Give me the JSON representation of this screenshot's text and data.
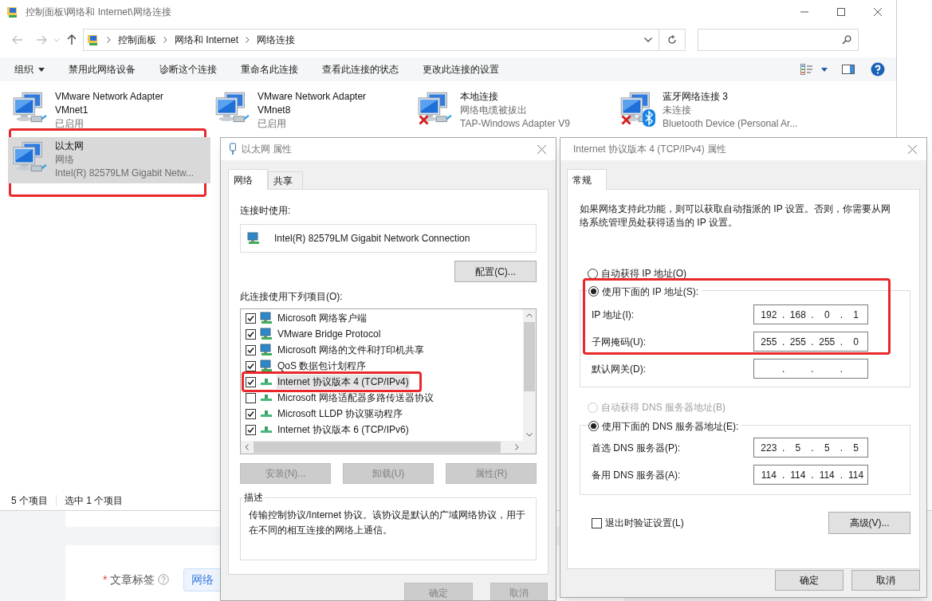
{
  "explorer": {
    "title": "控制面板\\网络和 Internet\\网络连接",
    "breadcrumbs": [
      "控制面板",
      "网络和 Internet",
      "网络连接"
    ],
    "organize": "组织",
    "commands": [
      "禁用此网络设备",
      "诊断这个连接",
      "重命名此连接",
      "查看此连接的状态",
      "更改此连接的设置"
    ],
    "adapters": [
      {
        "name_lines": [
          "VMware Network Adapter",
          "VMnet1"
        ],
        "details": [
          "已启用"
        ],
        "connected": true,
        "bluetooth": false,
        "selected": false,
        "annotated": false
      },
      {
        "name_lines": [
          "VMware Network Adapter",
          "VMnet8"
        ],
        "details": [
          "已启用"
        ],
        "connected": true,
        "bluetooth": false,
        "selected": false,
        "annotated": false
      },
      {
        "name_lines": [
          "本地连接"
        ],
        "details": [
          "网络电缆被拔出",
          "TAP-Windows Adapter V9"
        ],
        "connected": false,
        "bluetooth": false,
        "selected": false,
        "annotated": false
      },
      {
        "name_lines": [
          "蓝牙网络连接 3"
        ],
        "details": [
          "未连接",
          "Bluetooth Device (Personal Ar..."
        ],
        "connected": false,
        "bluetooth": true,
        "selected": false,
        "annotated": false
      },
      {
        "name_lines": [
          "以太网"
        ],
        "details": [
          "网络",
          "Intel(R) 82579LM Gigabit Netw..."
        ],
        "connected": true,
        "bluetooth": false,
        "selected": true,
        "annotated": true
      }
    ],
    "status_bar": [
      "5 个项目",
      "选中 1 个项目"
    ]
  },
  "background_page": {
    "required_mark": "*",
    "label": "文章标签",
    "tag": "网络"
  },
  "ethernet_dialog": {
    "title": "以太网 属性",
    "tabs": [
      {
        "label": "网络",
        "selected": true
      },
      {
        "label": "共享",
        "selected": false
      }
    ],
    "connect_using_label": "连接时使用:",
    "adapter": "Intel(R) 82579LM Gigabit Network Connection",
    "configure_button": "配置(C)...",
    "items_label": "此连接使用下列项目(O):",
    "items": [
      {
        "label": "Microsoft 网络客户端",
        "kind": "client",
        "checked": true,
        "selected": false,
        "annotated": false
      },
      {
        "label": "VMware Bridge Protocol",
        "kind": "service",
        "checked": true,
        "selected": false,
        "annotated": false
      },
      {
        "label": "Microsoft 网络的文件和打印机共享",
        "kind": "service",
        "checked": true,
        "selected": false,
        "annotated": false
      },
      {
        "label": "QoS 数据包计划程序",
        "kind": "service",
        "checked": true,
        "selected": false,
        "annotated": false
      },
      {
        "label": "Internet 协议版本 4 (TCP/IPv4)",
        "kind": "protocol",
        "checked": true,
        "selected": true,
        "annotated": true
      },
      {
        "label": "Microsoft 网络适配器多路传送器协议",
        "kind": "protocol",
        "checked": false,
        "selected": false,
        "annotated": false
      },
      {
        "label": "Microsoft LLDP 协议驱动程序",
        "kind": "protocol",
        "checked": true,
        "selected": false,
        "annotated": false
      },
      {
        "label": "Internet 协议版本 6 (TCP/IPv6)",
        "kind": "protocol",
        "checked": true,
        "selected": false,
        "annotated": false
      }
    ],
    "buttons": [
      {
        "label": "安装(N)...",
        "disabled": true
      },
      {
        "label": "卸载(U)",
        "disabled": true
      },
      {
        "label": "属性(R)",
        "disabled": true
      }
    ],
    "description_legend": "描述",
    "description": "传输控制协议/Internet 协议。该协议是默认的广域网络协议，用于在不同的相互连接的网络上通信。",
    "footer_buttons": [
      {
        "label": "确定",
        "disabled": true
      },
      {
        "label": "取消",
        "disabled": true
      }
    ]
  },
  "ipv4_dialog": {
    "title": "Internet 协议版本 4 (TCP/IPv4) 属性",
    "tabs": [
      {
        "label": "常规",
        "selected": true
      }
    ],
    "intro": "如果网络支持此功能，则可以获取自动指派的 IP 设置。否则，你需要从网络系统管理员处获得适当的 IP 设置。",
    "ip_auto": {
      "label": "自动获得 IP 地址(O)",
      "selected": false,
      "disabled": false
    },
    "ip_manual": {
      "label": "使用下面的 IP 地址(S):",
      "selected": true,
      "disabled": false,
      "annotated": true
    },
    "ip_fields": [
      {
        "label": "IP 地址(I):",
        "value": "192 . 168 . 0 . 1"
      },
      {
        "label": "子网掩码(U):",
        "value": "255 . 255 . 255 . 0"
      },
      {
        "label": "默认网关(D):",
        "value": ". . ."
      }
    ],
    "dns_auto": {
      "label": "自动获得 DNS 服务器地址(B)",
      "selected": false,
      "disabled": true
    },
    "dns_manual": {
      "label": "使用下面的 DNS 服务器地址(E):",
      "selected": true,
      "disabled": false
    },
    "dns_fields": [
      {
        "label": "首选 DNS 服务器(P):",
        "value": "223 . 5 . 5 . 5"
      },
      {
        "label": "备用 DNS 服务器(A):",
        "value": "114 . 114 . 114 . 114"
      }
    ],
    "validate": {
      "label": "退出时验证设置(L)",
      "checked": false
    },
    "advanced_button": "高级(V)...",
    "footer_buttons": [
      {
        "label": "确定",
        "disabled": false
      },
      {
        "label": "取消",
        "disabled": false
      }
    ]
  }
}
